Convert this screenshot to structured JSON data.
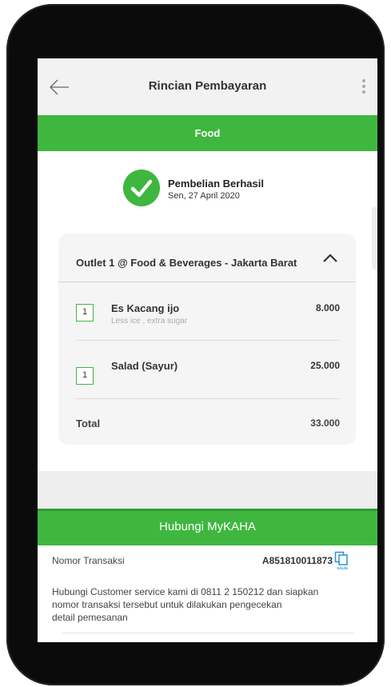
{
  "header": {
    "title": "Rincian Pembayaran"
  },
  "category_banner": {
    "label": "Food"
  },
  "status": {
    "title": "Pembelian Berhasil",
    "date": "Sen, 27 April 2020"
  },
  "order": {
    "outlet": "Outlet 1 @ Food & Beverages - Jakarta Barat",
    "items": [
      {
        "qty": "1",
        "name": "Es Kacang ijo",
        "note": "Less ice , extra sugar",
        "price": "8.000"
      },
      {
        "qty": "1",
        "name": "Salad (Sayur)",
        "note": "",
        "price": "25.000"
      }
    ],
    "total_label": "Total",
    "total_value": "33.000"
  },
  "contact": {
    "title": "Hubungi MyKAHA",
    "transaction_label": "Nomor Transaksi",
    "transaction_number": "A851810011873",
    "copy_label": "SALIN",
    "info": "Hubungi Customer service kami di 0811 2 150212 dan siapkan\nnomor transaksi tersebut untuk dilakukan pengecekan\ndetail pemesanan"
  },
  "colors": {
    "accent": "#3fb73f",
    "accent_dark": "#2f9c2f",
    "copy_icon": "#2a8fd9"
  },
  "icons": [
    "back-arrow-icon",
    "more-vertical-icon",
    "check-circle-icon",
    "chevron-up-icon",
    "copy-icon"
  ]
}
